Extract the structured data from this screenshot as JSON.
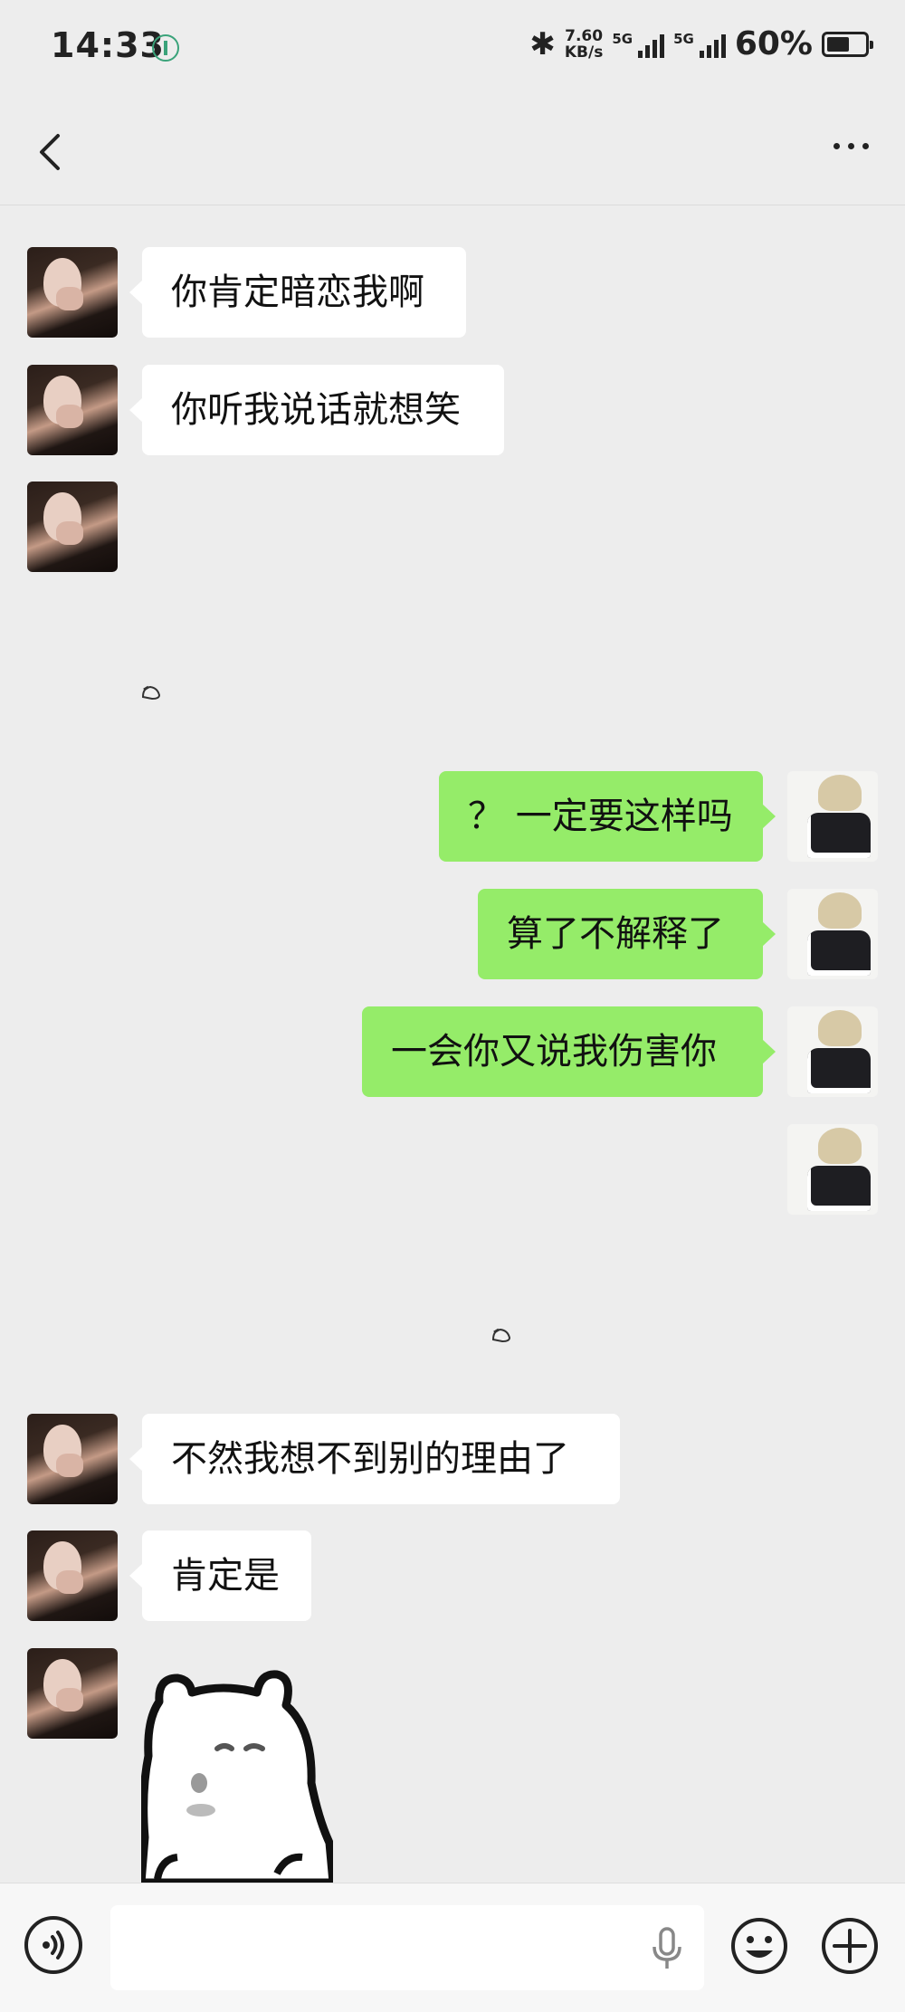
{
  "status_bar": {
    "time": "14:33",
    "net_speed_value": "7.60",
    "net_speed_unit": "KB/s",
    "sim1_label": "5G",
    "sim2_label": "5G",
    "battery_percent": "60%",
    "battery_level": 0.6
  },
  "messages": [
    {
      "side": "left",
      "text": "你肯定暗恋我啊"
    },
    {
      "side": "left",
      "text": "你听我说话就想笑"
    },
    {
      "side": "left",
      "text": ""
    },
    {
      "side": "right",
      "text": "？ 一定要这样吗"
    },
    {
      "side": "right",
      "text": "算了不解释了"
    },
    {
      "side": "right",
      "text": "一会你又说我伤害你"
    },
    {
      "side": "right",
      "text": ""
    },
    {
      "side": "left",
      "text": "不然我想不到别的理由了"
    },
    {
      "side": "left",
      "text": "肯定是"
    },
    {
      "side": "left",
      "text": ""
    }
  ],
  "icons": {
    "back": "chevron-left-icon",
    "more": "more-dots-icon",
    "voice": "voice-mode-icon",
    "mic": "microphone-icon",
    "emoji": "emoji-icon",
    "plus": "plus-icon"
  },
  "colors": {
    "background": "#ededed",
    "bubble_incoming": "#ffffff",
    "bubble_outgoing": "#95ec69"
  }
}
